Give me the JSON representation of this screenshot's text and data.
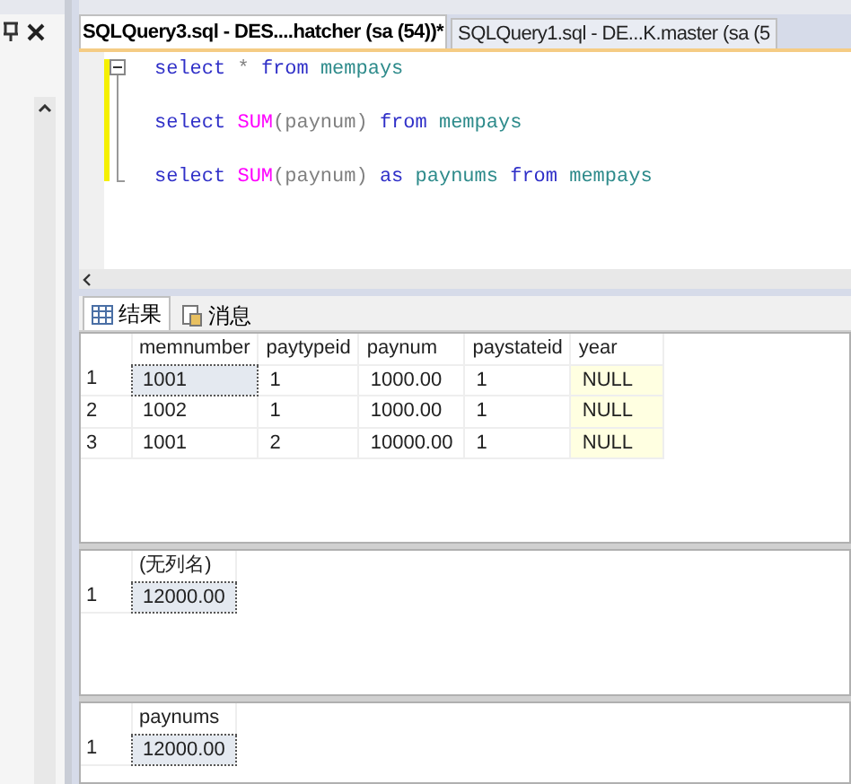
{
  "tabs": [
    {
      "label": "SQLQuery3.sql - DES....hatcher (sa (54))*",
      "selected": true
    },
    {
      "label": "SQLQuery1.sql - DE...K.master (sa (5",
      "selected": false
    }
  ],
  "editor": {
    "lines": [
      {
        "tokens": [
          {
            "text": "select",
            "kind": "keyword"
          },
          {
            "text": "*",
            "kind": "operator"
          },
          {
            "text": "from",
            "kind": "keyword"
          },
          {
            "text": "mempays",
            "kind": "identifier"
          }
        ]
      },
      {
        "tokens": [
          {
            "text": "select",
            "kind": "keyword"
          },
          {
            "text": "SUM",
            "kind": "function"
          },
          {
            "text": "(paynum)",
            "kind": "args"
          },
          {
            "text": "from",
            "kind": "keyword"
          },
          {
            "text": "mempays",
            "kind": "identifier"
          }
        ]
      },
      {
        "tokens": [
          {
            "text": "select",
            "kind": "keyword"
          },
          {
            "text": "SUM",
            "kind": "function"
          },
          {
            "text": "(paynum)",
            "kind": "args"
          },
          {
            "text": "as",
            "kind": "keyword"
          },
          {
            "text": "paynums",
            "kind": "identifier"
          },
          {
            "text": "from",
            "kind": "keyword"
          },
          {
            "text": "mempays",
            "kind": "identifier"
          }
        ]
      }
    ]
  },
  "results_tabs": [
    {
      "label": "结果",
      "selected": true
    },
    {
      "label": "消息",
      "selected": false
    }
  ],
  "grids": [
    {
      "columns": [
        "memnumber",
        "paytypeid",
        "paynum",
        "paystateid",
        "year"
      ],
      "rows": [
        {
          "number": "1",
          "cells": [
            {
              "text": "1001",
              "selected": true,
              "null": false
            },
            {
              "text": "1",
              "selected": false,
              "null": false
            },
            {
              "text": "1000.00",
              "selected": false,
              "null": false
            },
            {
              "text": "1",
              "selected": false,
              "null": false
            },
            {
              "text": "NULL",
              "selected": false,
              "null": true
            }
          ]
        },
        {
          "number": "2",
          "cells": [
            {
              "text": "1002",
              "selected": false,
              "null": false
            },
            {
              "text": "1",
              "selected": false,
              "null": false
            },
            {
              "text": "1000.00",
              "selected": false,
              "null": false
            },
            {
              "text": "1",
              "selected": false,
              "null": false
            },
            {
              "text": "NULL",
              "selected": false,
              "null": true
            }
          ]
        },
        {
          "number": "3",
          "cells": [
            {
              "text": "1001",
              "selected": false,
              "null": false
            },
            {
              "text": "2",
              "selected": false,
              "null": false
            },
            {
              "text": "10000.00",
              "selected": false,
              "null": false
            },
            {
              "text": "1",
              "selected": false,
              "null": false
            },
            {
              "text": "NULL",
              "selected": false,
              "null": true
            }
          ]
        }
      ]
    },
    {
      "columns": [
        "(无列名)"
      ],
      "rows": [
        {
          "number": "1",
          "cells": [
            {
              "text": "12000.00",
              "selected": true,
              "null": false
            }
          ]
        }
      ]
    },
    {
      "columns": [
        "paynums"
      ],
      "rows": [
        {
          "number": "1",
          "cells": [
            {
              "text": "12000.00",
              "selected": true,
              "null": false
            }
          ]
        }
      ]
    }
  ]
}
